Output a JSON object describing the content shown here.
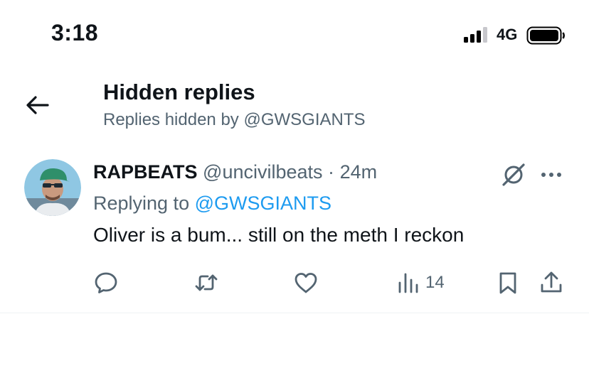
{
  "status_bar": {
    "time": "3:18",
    "network": "4G"
  },
  "header": {
    "back_icon": "arrow-left-icon",
    "title": "Hidden replies",
    "subtitle": "Replies hidden by @GWSGIANTS"
  },
  "tweet": {
    "display_name": "RAPBEATS",
    "handle": "@uncivilbeats",
    "separator": "·",
    "time_ago": "24m",
    "replying_prefix": "Replying to",
    "replying_to": "@GWSGIANTS",
    "text": "Oliver is a bum... still on the meth I reckon",
    "status_icon": "hidden-reply-icon",
    "more_icon": "more-horizontal-icon",
    "actions": {
      "reply_icon": "reply-icon",
      "retweet_icon": "retweet-icon",
      "like_icon": "like-icon",
      "views_icon": "views-icon",
      "views_count": "14",
      "bookmark_icon": "bookmark-icon",
      "share_icon": "share-icon"
    }
  },
  "colors": {
    "text_primary": "#0f1419",
    "text_secondary": "#536471",
    "link": "#1d9bf0",
    "divider": "#eff3f4"
  }
}
